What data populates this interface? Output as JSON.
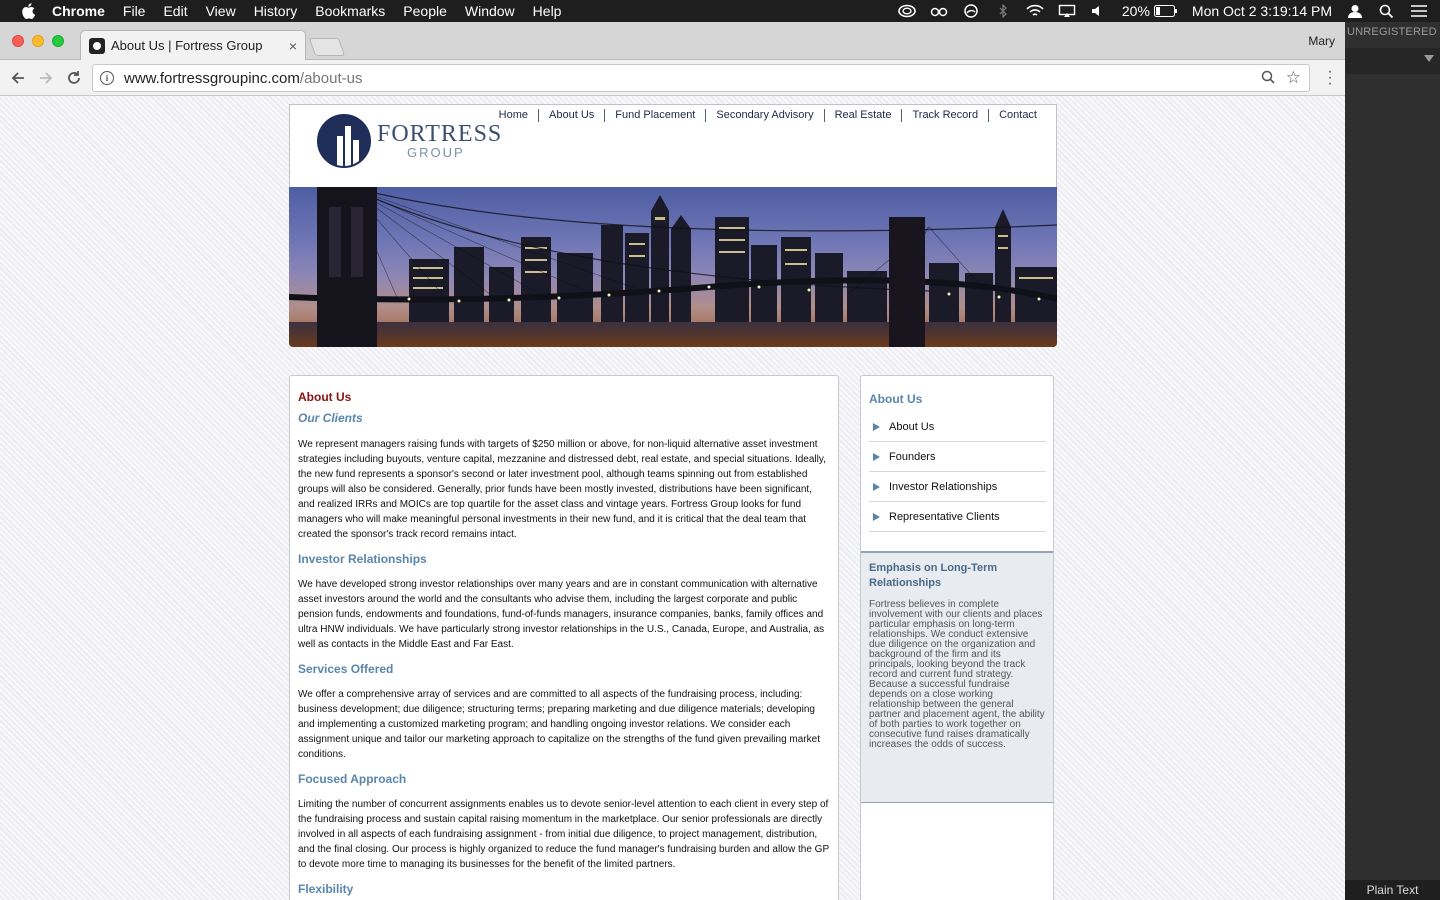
{
  "menubar": {
    "app": "Chrome",
    "items": [
      "File",
      "Edit",
      "View",
      "History",
      "Bookmarks",
      "People",
      "Window",
      "Help"
    ],
    "battery": "20%",
    "clock": "Mon Oct 2  3:19:14 PM"
  },
  "editor": {
    "unregistered": "UNREGISTERED",
    "status_syntax": "Plain Text"
  },
  "browser": {
    "tab_title": "About Us | Fortress Group",
    "tab_close": "×",
    "profile": "Mary",
    "url_host": "www.fortressgroupinc.com",
    "url_path": "/about-us"
  },
  "site": {
    "logo": {
      "line1": "FORTRESS",
      "line2": "GROUP"
    },
    "nav": [
      "Home",
      "About Us",
      "Fund Placement",
      "Secondary Advisory",
      "Real Estate",
      "Track Record",
      "Contact"
    ],
    "main": {
      "heading": "About Us",
      "sections": [
        {
          "title": "Our Clients",
          "italic": true,
          "body": "We represent managers raising funds with targets of $250 million or above, for non-liquid alternative asset investment strategies including buyouts, venture capital, mezzanine and distressed debt, real estate, and special situations. Ideally, the new fund represents a sponsor's second or later investment pool, although teams spinning out from established groups will also be considered. Generally, prior funds have been mostly invested, distributions have been significant, and realized IRRs and MOICs are top quartile for the asset class and vintage years. Fortress Group looks for fund managers who will make meaningful personal investments in their new fund, and it is critical that the deal team that created the sponsor's track record remains intact."
        },
        {
          "title": "Investor Relationships",
          "italic": false,
          "body": "We have developed strong investor relationships over many years and are in constant communication with alternative asset investors around the world and the consultants who advise them, including the largest corporate and public pension funds, endowments and foundations, fund-of-funds managers, insurance companies, banks, family offices and ultra HNW individuals. We have particularly strong investor relationships in the U.S., Canada, Europe, and Australia, as well as contacts in the Middle East and Far East."
        },
        {
          "title": "Services Offered",
          "italic": false,
          "body": "We offer a comprehensive array of services and are committed to all aspects of the fundraising process, including: business development; due diligence; structuring terms; preparing marketing and due diligence materials; developing and implementing a customized marketing program; and handling ongoing investor relations. We consider each assignment unique and tailor our marketing approach to capitalize on the strengths of the fund given prevailing market conditions."
        },
        {
          "title": "Focused Approach",
          "italic": false,
          "body": "Limiting the number of concurrent assignments enables us to devote senior-level attention to each client in every step of the fundraising process and sustain capital raising momentum in the marketplace. Our senior professionals are directly involved in all aspects of each fundraising assignment - from initial due diligence, to project management, distribution, and the final closing. Our process is highly organized to reduce the fund manager's fundraising burden and allow the GP to devote more time to managing its businesses for the benefit of the limited partners."
        },
        {
          "title": "Flexibility",
          "italic": false,
          "body": ""
        }
      ]
    },
    "sidebar": {
      "title": "About Us",
      "links": [
        "About Us",
        "Founders",
        "Investor Relationships",
        "Representative Clients"
      ],
      "emphasis_title": "Emphasis on Long-Term Relationships",
      "emphasis_body": "Fortress believes in complete involvement with our clients and places particular emphasis on long-term relationships. We conduct extensive due diligence on the organization and background of the firm and its principals, looking beyond the track record and current fund strategy. Because a successful fundraise depends on a close working relationship between the general partner and placement agent, the ability of both parties to work together on consecutive fund raises dramatically increases the odds of success."
    }
  }
}
